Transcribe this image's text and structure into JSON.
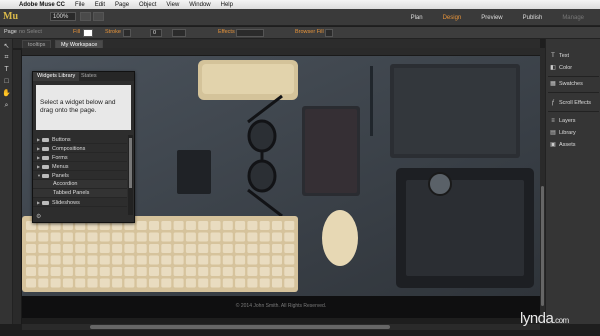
{
  "menubar": {
    "items": [
      "Adobe Muse CC",
      "File",
      "Edit",
      "Page",
      "Object",
      "View",
      "Window",
      "Help"
    ]
  },
  "appbar": {
    "logo": "Mu",
    "zoom": "100%",
    "modes": [
      "Plan",
      "Design",
      "Preview",
      "Publish",
      "Manage"
    ],
    "active_mode": "Design"
  },
  "controlbar": {
    "page_label": "Page",
    "page_value": "no Select",
    "fill": "Fill",
    "stroke": "Stroke",
    "stroke_value": "0",
    "effects": "Effects",
    "browser_fill": "Browser Fill"
  },
  "doc_tabs": [
    "tooltips",
    "My Workspace"
  ],
  "right_panel": {
    "items": [
      "Text",
      "Color",
      "Swatches",
      "Scroll Effects",
      "Layers",
      "Library",
      "Assets"
    ]
  },
  "widgets_panel": {
    "tabs": [
      "Widgets Library",
      "States"
    ],
    "preview_text": "Select a widget below and drag onto the page.",
    "items": [
      {
        "label": "Buttons",
        "type": "folder"
      },
      {
        "label": "Compositions",
        "type": "folder"
      },
      {
        "label": "Forms",
        "type": "folder"
      },
      {
        "label": "Menus",
        "type": "folder"
      },
      {
        "label": "Panels",
        "type": "folder-open"
      },
      {
        "label": "Accordion",
        "type": "child"
      },
      {
        "label": "Tabbed Panels",
        "type": "child"
      },
      {
        "label": "Slideshows",
        "type": "folder"
      }
    ]
  },
  "footer": {
    "copyright": "© 2014 John Smith. All Rights Reserved."
  },
  "watermark": "lynda.com",
  "colors": {
    "accent": "#e8943a",
    "canvas": "#3c4148"
  }
}
